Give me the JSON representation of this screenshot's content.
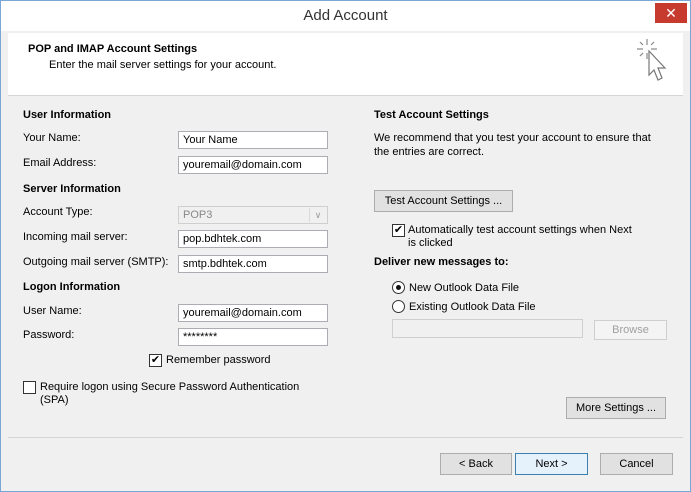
{
  "window": {
    "title": "Add Account",
    "close_glyph": "✕"
  },
  "header": {
    "title": "POP and IMAP Account Settings",
    "subtitle": "Enter the mail server settings for your account.",
    "icon": "wand-cursor-icon"
  },
  "user_info": {
    "heading": "User Information",
    "name_label": "Your Name:",
    "name_value": "Your Name",
    "email_label": "Email Address:",
    "email_value": "youremail@domain.com"
  },
  "server_info": {
    "heading": "Server Information",
    "account_type_label": "Account Type:",
    "account_type_value": "POP3",
    "incoming_label": "Incoming mail server:",
    "incoming_value": "pop.bdhtek.com",
    "outgoing_label": "Outgoing mail server (SMTP):",
    "outgoing_value": "smtp.bdhtek.com"
  },
  "logon_info": {
    "heading": "Logon Information",
    "username_label": "User Name:",
    "username_value": "youremail@domain.com",
    "password_label": "Password:",
    "password_value": "********",
    "remember_label": "Remember password",
    "remember_checked": true,
    "spa_label_line1": "Require logon using Secure Password Authentication",
    "spa_label_line2": "(SPA)",
    "spa_checked": false
  },
  "test_settings": {
    "heading": "Test Account Settings",
    "desc_line1": "We recommend that you test your account to ensure that",
    "desc_line2": "the entries are correct.",
    "test_button": "Test Account Settings ...",
    "auto_test_line1": "Automatically test account settings when Next",
    "auto_test_line2": "is clicked",
    "auto_test_checked": true
  },
  "deliver": {
    "heading": "Deliver new messages to:",
    "option_new": "New Outlook Data File",
    "option_existing": "Existing Outlook Data File",
    "selected": "new",
    "path_value": "",
    "browse_button": "Browse"
  },
  "buttons": {
    "more_settings": "More Settings ...",
    "back": "< Back",
    "next": "Next >",
    "cancel": "Cancel"
  }
}
